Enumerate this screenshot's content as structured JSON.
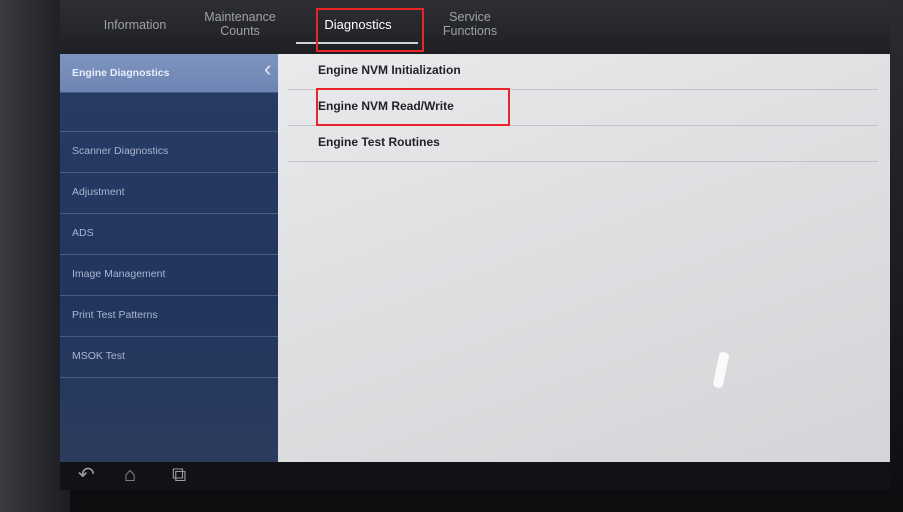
{
  "tabs": [
    {
      "label": "Information"
    },
    {
      "label": "Maintenance\nCounts"
    },
    {
      "label": "Diagnostics"
    },
    {
      "label": "Service\nFunctions"
    }
  ],
  "sidebar": {
    "items": [
      {
        "label": "Engine Diagnostics"
      },
      {
        "label": ""
      },
      {
        "label": "Scanner Diagnostics"
      },
      {
        "label": "Adjustment"
      },
      {
        "label": "ADS"
      },
      {
        "label": "Image Management"
      },
      {
        "label": "Print Test Patterns"
      },
      {
        "label": "MSOK Test"
      }
    ]
  },
  "content": {
    "items": [
      {
        "label": "Engine NVM Initialization"
      },
      {
        "label": "Engine NVM Read/Write"
      },
      {
        "label": "Engine Test Routines"
      }
    ]
  },
  "colors": {
    "highlight_box": "#e8262a",
    "sidebar_bg": "#22355e",
    "sidebar_selected": "#7e94c0"
  },
  "icons": [
    "back-icon",
    "home-icon",
    "recent-apps-icon"
  ]
}
